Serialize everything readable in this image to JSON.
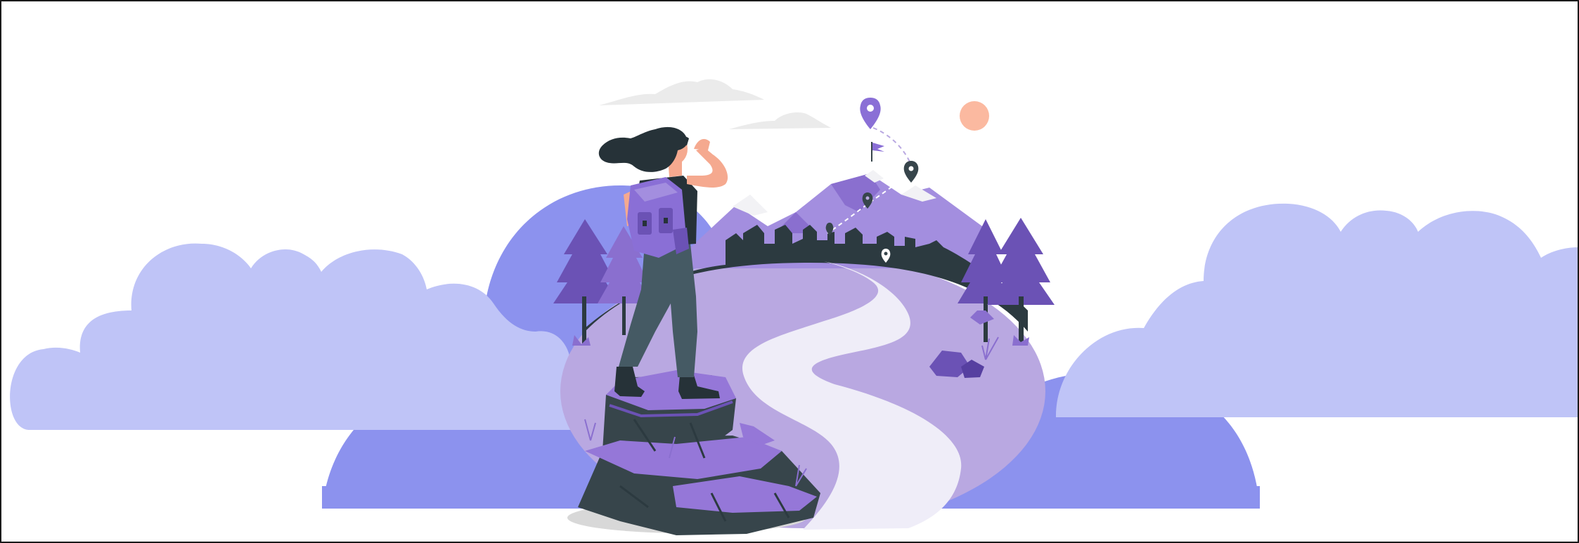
{
  "illustration": {
    "subject": "hiker-on-rock-looking-at-mountain-trail",
    "colors": {
      "background": "#ffffff",
      "border": "#1a1a1a",
      "cloud_light": "#bfc4f7",
      "hill_blue": "#8c92ee",
      "meadow": "#b9a8e1",
      "path": "#efedf8",
      "mountain": "#a38edf",
      "mountain_dark": "#8a6fcf",
      "snow": "#f2f2f5",
      "city": "#2c3a40",
      "tree": "#6b52b5",
      "rock_dark": "#37454b",
      "rock_top": "#9577d8",
      "skin": "#f5a98f",
      "hair": "#263238",
      "pants": "#455a64",
      "backpack": "#8a6fd6",
      "sun": "#fbb9a0",
      "pin_purple": "#8a6fd6",
      "pin_dark": "#37454b",
      "sky_cloud": "#ebebeb"
    },
    "icons": [
      "map-pin-icon",
      "flag-icon",
      "sun-icon"
    ]
  }
}
